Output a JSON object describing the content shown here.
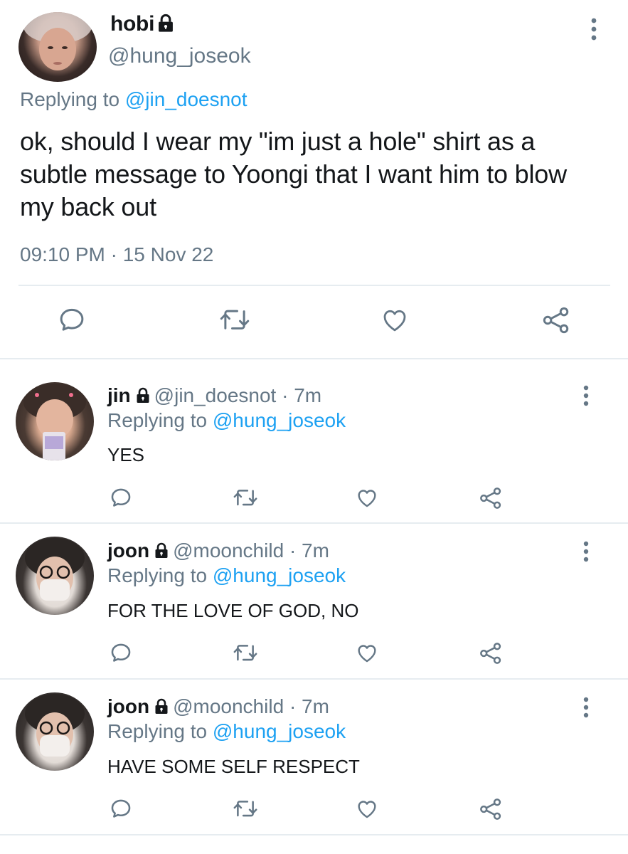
{
  "main_tweet": {
    "name": "hobi",
    "handle": "@hung_joseok",
    "replying_prefix": "Replying to",
    "replying_mention": "@jin_doesnot",
    "text": "ok, should I wear my \"im just a hole\" shirt as a subtle message to Yoongi that I want him to blow my back out",
    "timestamp": "09:10 PM · 15 Nov 22"
  },
  "replies": [
    {
      "name": "jin",
      "handle": "@jin_doesnot",
      "time": "· 7m",
      "replying_prefix": "Replying to",
      "replying_mention": "@hung_joseok",
      "text": "YES"
    },
    {
      "name": "joon",
      "handle": "@moonchild",
      "time": "· 7m",
      "replying_prefix": "Replying to",
      "replying_mention": "@hung_joseok",
      "text": "FOR THE LOVE OF GOD, NO"
    },
    {
      "name": "joon",
      "handle": "@moonchild",
      "time": "· 7m",
      "replying_prefix": "Replying to",
      "replying_mention": "@hung_joseok",
      "text": "HAVE SOME SELF RESPECT"
    }
  ],
  "icons": {
    "reply": "speech-bubble-icon",
    "retweet": "retweet-icon",
    "like": "heart-icon",
    "share": "share-icon",
    "more": "more-vertical-icon",
    "lock": "lock-icon"
  },
  "colors": {
    "text": "#14171a",
    "secondary": "#657786",
    "accent": "#1da1f2",
    "divider": "#e6ecf0"
  }
}
